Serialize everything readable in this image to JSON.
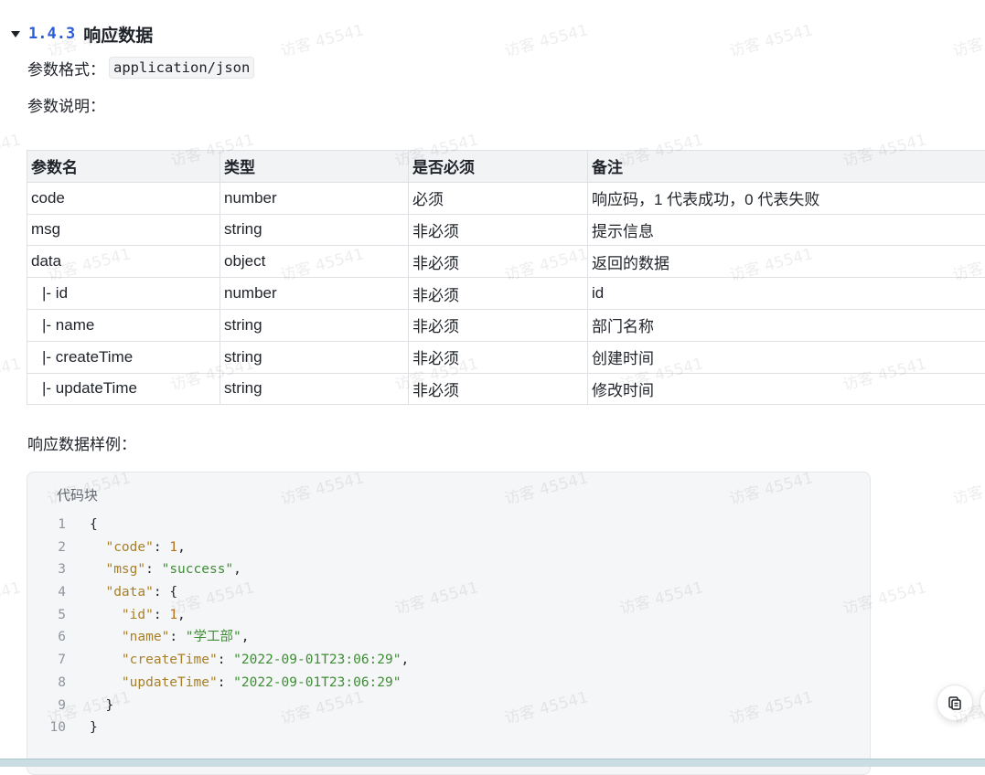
{
  "watermark_text": "访客 45541",
  "section": {
    "number": "1.4.3",
    "title": "响应数据"
  },
  "format_label": "参数格式：",
  "format_value": "application/json",
  "desc_label": "参数说明：",
  "table": {
    "headers": [
      "参数名",
      "类型",
      "是否必须",
      "备注"
    ],
    "rows": [
      [
        "code",
        "number",
        "必须",
        "响应码，1 代表成功，0 代表失败"
      ],
      [
        "msg",
        "string",
        "非必须",
        "提示信息"
      ],
      [
        "data",
        "object",
        "非必须",
        "返回的数据"
      ],
      [
        "|- id",
        "number",
        "非必须",
        "id"
      ],
      [
        "|- name",
        "string",
        "非必须",
        "部门名称"
      ],
      [
        "|- createTime",
        "string",
        "非必须",
        "创建时间"
      ],
      [
        "|- updateTime",
        "string",
        "非必须",
        "修改时间"
      ]
    ]
  },
  "sample_label": "响应数据样例：",
  "code_block": {
    "caption": "代码块",
    "lines": [
      {
        "n": "1",
        "tokens": [
          [
            "p",
            "{"
          ]
        ]
      },
      {
        "n": "2",
        "tokens": [
          [
            "p",
            "  "
          ],
          [
            "k",
            "\"code\""
          ],
          [
            "p",
            ": "
          ],
          [
            "n",
            "1"
          ],
          [
            "p",
            ","
          ]
        ]
      },
      {
        "n": "3",
        "tokens": [
          [
            "p",
            "  "
          ],
          [
            "k",
            "\"msg\""
          ],
          [
            "p",
            ": "
          ],
          [
            "s",
            "\"success\""
          ],
          [
            "p",
            ","
          ]
        ]
      },
      {
        "n": "4",
        "tokens": [
          [
            "p",
            "  "
          ],
          [
            "k",
            "\"data\""
          ],
          [
            "p",
            ": {"
          ]
        ]
      },
      {
        "n": "5",
        "tokens": [
          [
            "p",
            "    "
          ],
          [
            "k",
            "\"id\""
          ],
          [
            "p",
            ": "
          ],
          [
            "n",
            "1"
          ],
          [
            "p",
            ","
          ]
        ]
      },
      {
        "n": "6",
        "tokens": [
          [
            "p",
            "    "
          ],
          [
            "k",
            "\"name\""
          ],
          [
            "p",
            ": "
          ],
          [
            "s",
            "\"学工部\""
          ],
          [
            "p",
            ","
          ]
        ]
      },
      {
        "n": "7",
        "tokens": [
          [
            "p",
            "    "
          ],
          [
            "k",
            "\"createTime\""
          ],
          [
            "p",
            ": "
          ],
          [
            "s",
            "\"2022-09-01T23:06:29\""
          ],
          [
            "p",
            ","
          ]
        ]
      },
      {
        "n": "8",
        "tokens": [
          [
            "p",
            "    "
          ],
          [
            "k",
            "\"updateTime\""
          ],
          [
            "p",
            ": "
          ],
          [
            "s",
            "\"2022-09-01T23:06:29\""
          ]
        ]
      },
      {
        "n": "9",
        "tokens": [
          [
            "p",
            "  }"
          ]
        ]
      },
      {
        "n": "10",
        "tokens": [
          [
            "p",
            "}"
          ]
        ]
      }
    ]
  },
  "icons": {
    "float_button": "copy-icon"
  },
  "colors": {
    "heading_number": "#2b5dd9",
    "json_key": "#a7802b",
    "json_string": "#3f8d36",
    "json_number": "#b5701a"
  }
}
